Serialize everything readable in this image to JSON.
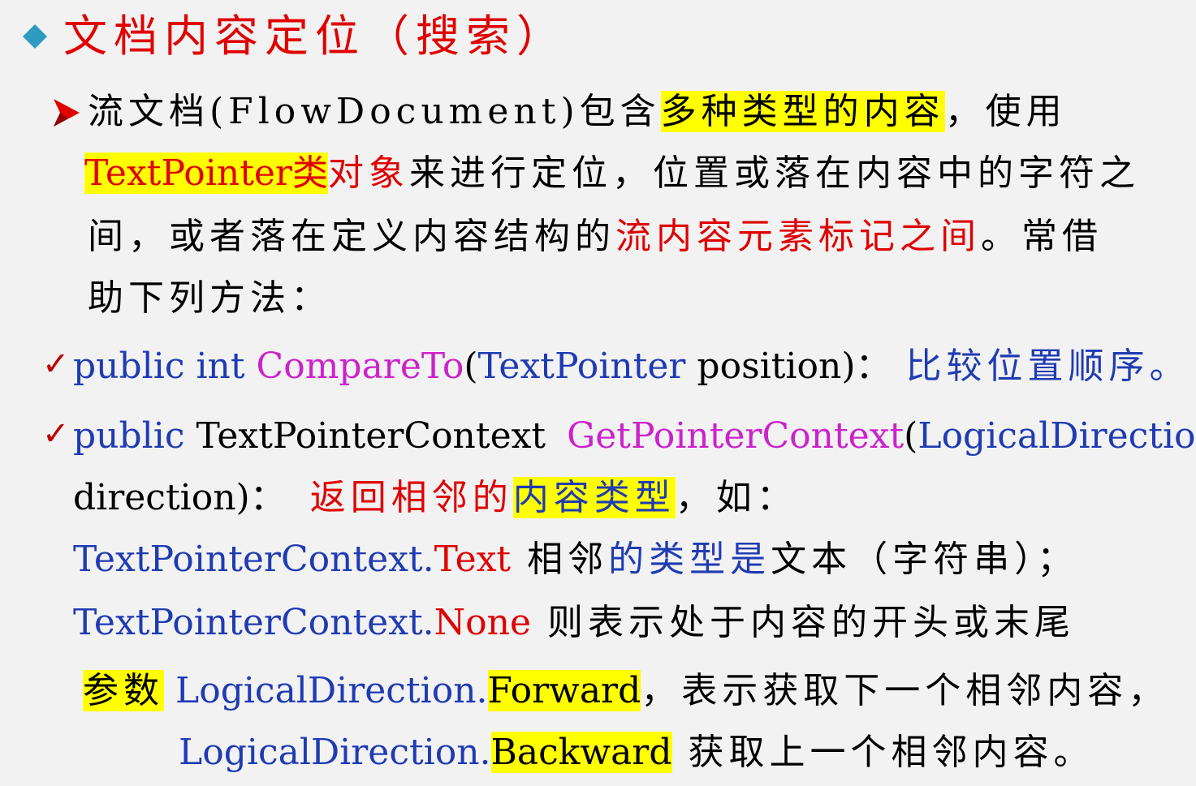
{
  "title": "文档内容定位（搜索）",
  "bullet": {
    "p1": "流文档(FlowDocument)包含",
    "p1_hl": "多种类型的内容",
    "p1_end": "，使用",
    "p2_hl": "TextPointer类",
    "p2_red": "对象",
    "p2_end": "来进行定位，位置或落在内容中的字符之",
    "p3a": "间，或者落在定义内容结构的",
    "p3_red": "流内容元素标记之间",
    "p3_end": "。常借",
    "p4": "助下列方法："
  },
  "method1": {
    "check": "✓",
    "kw": "public int ",
    "name": "CompareTo",
    "paren_open": "(",
    "type": "TextPointer",
    "param": " position)：",
    "desc": "比较位置顺序。"
  },
  "method2": {
    "check": "✓",
    "kw": "public ",
    "ret": "TextPointerContext",
    "name": "GetPointerContext",
    "paren_open": "(",
    "type": "LogicalDirection",
    "param": "direction)：",
    "desc_red": "返回相邻的",
    "desc_hl": "内容类型",
    "desc_end": "，如："
  },
  "ctx1": {
    "cls": "TextPointerContext.",
    "member": "Text",
    "a": "  相邻",
    "b": "的类型是",
    "c": "文本（字符串）；"
  },
  "ctx2": {
    "cls": "TextPointerContext.",
    "member": "None",
    "text": "  则表示处于内容的开头或末尾"
  },
  "param1": {
    "hl": "参数",
    "cls": " LogicalDirection.",
    "member": "Forward",
    "text": "，表示获取下一个相邻内容，"
  },
  "param2": {
    "cls": "LogicalDirection.",
    "member": "Backward",
    "text": " 获取上一个相邻内容。"
  },
  "colors": {
    "title": "#e00000",
    "diamond": "#2e9bc0",
    "blue": "#1f3bb3",
    "magenta": "#cc22cc",
    "highlight": "#ffff00"
  }
}
